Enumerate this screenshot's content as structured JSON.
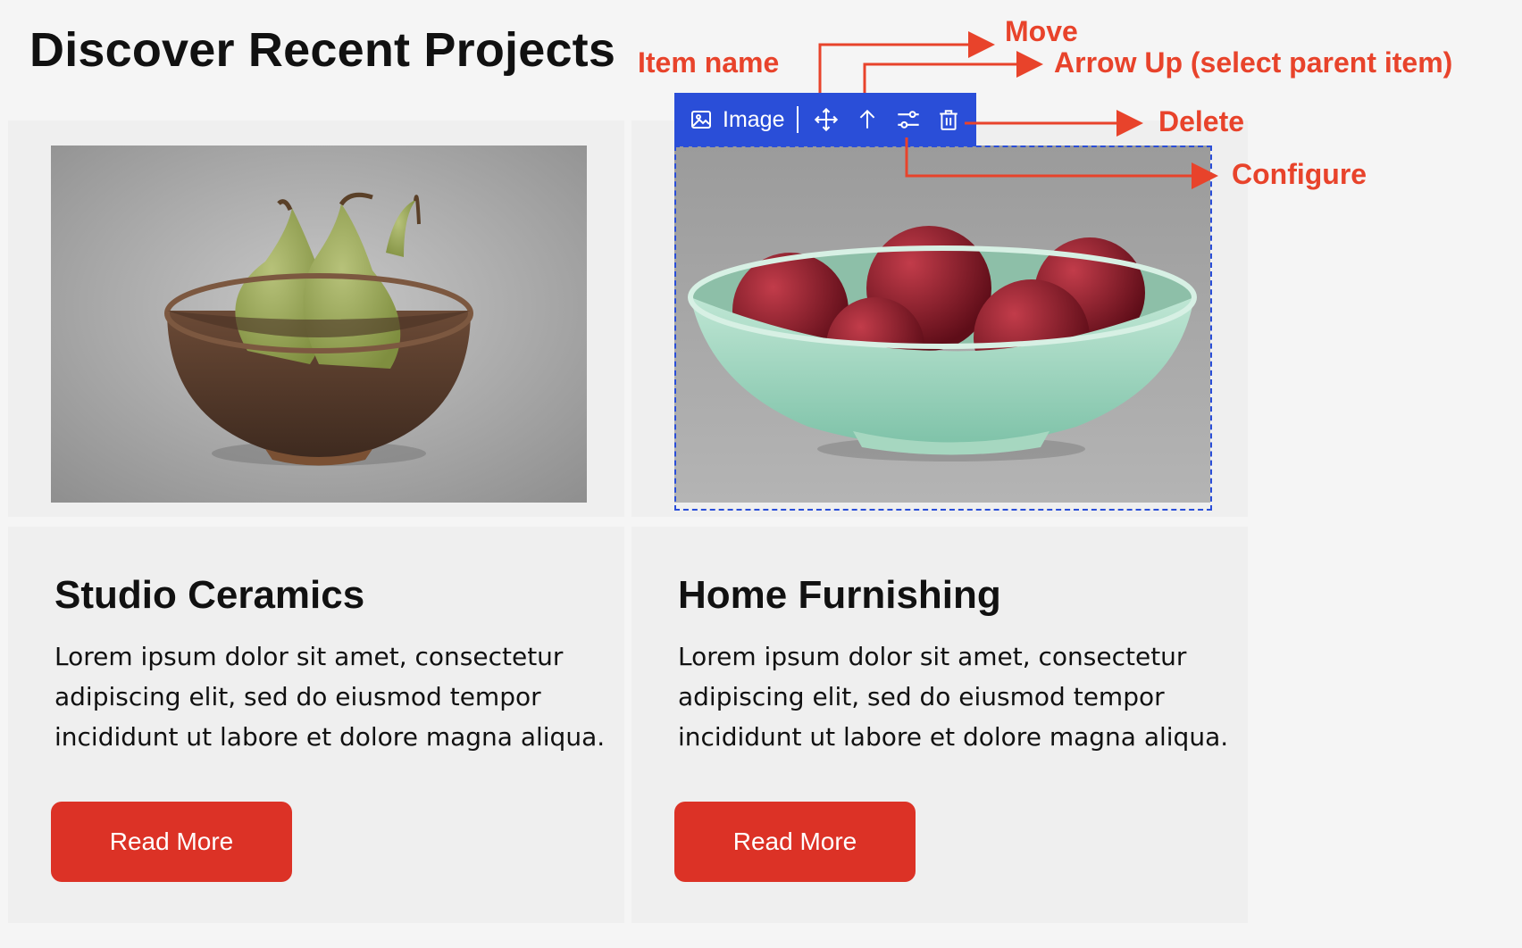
{
  "page": {
    "title": "Discover Recent Projects"
  },
  "toolbar": {
    "item_name": "Image",
    "icons": {
      "image": "image-icon",
      "move": "move-icon",
      "up": "arrow-up-icon",
      "configure": "sliders-icon",
      "delete": "trash-icon"
    },
    "background_color": "#2a4ed8"
  },
  "annotations": {
    "item_name": "Item name",
    "move": "Move",
    "arrow_up": "Arrow Up (select parent item)",
    "delete": "Delete",
    "configure": "Configure",
    "color": "#e8432b"
  },
  "cards": [
    {
      "title": "Studio Ceramics",
      "text": "Lorem ipsum dolor sit amet, consectetur adipiscing elit, sed do eiusmod tempor incididunt ut labore et dolore magna aliqua.",
      "button_label": "Read More"
    },
    {
      "title": "Home Furnishing",
      "text": "Lorem ipsum dolor sit amet, consectetur adipiscing elit, sed do eiusmod tempor incididunt ut labore et dolore magna aliqua.",
      "button_label": "Read More"
    }
  ],
  "colors": {
    "button": "#dc3226",
    "card_background": "#efefef",
    "page_background": "#f5f5f5"
  }
}
